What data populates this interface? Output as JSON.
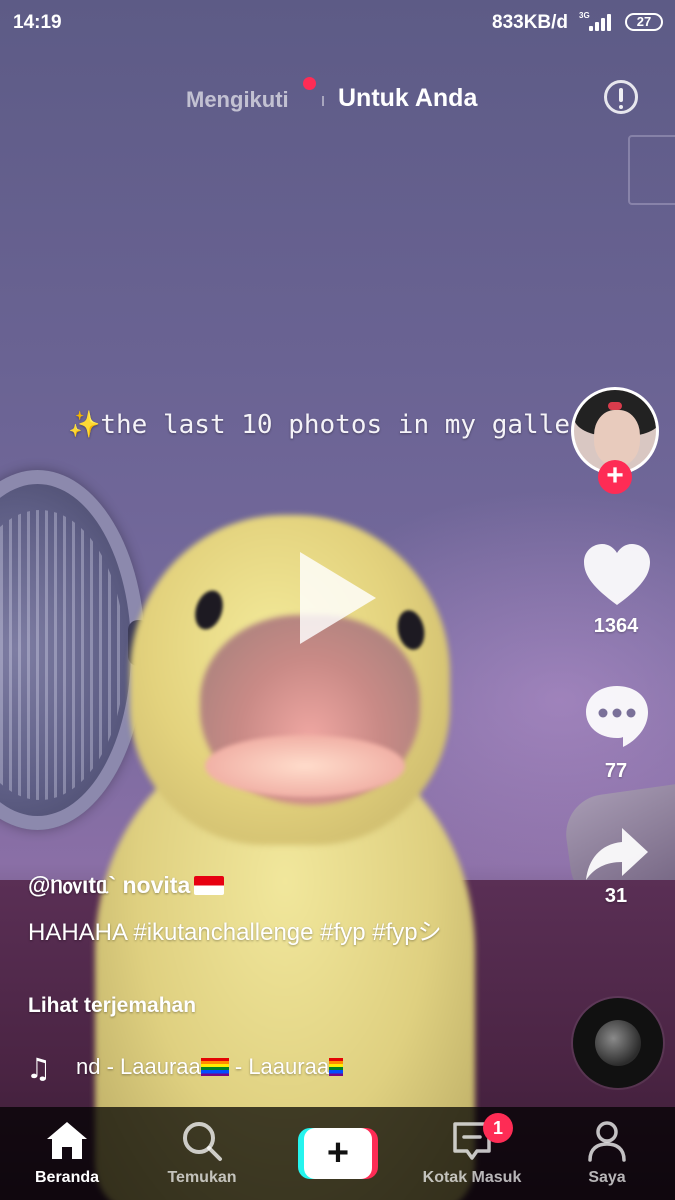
{
  "status_bar": {
    "time": "14:19",
    "network_speed": "833KB/d",
    "network_type": "3G",
    "battery": "27"
  },
  "top_tabs": {
    "following": "Mengikuti",
    "for_you": "Untuk Anda",
    "active": "for_you"
  },
  "video": {
    "overlay_caption": "the last 10 photos in my gallery",
    "state": "paused"
  },
  "actions": {
    "likes": "1364",
    "comments": "77",
    "shares": "31"
  },
  "post": {
    "username": "@ᥒ᥆᥎ιtᥲ` novita",
    "description": "HAHAHA #ikutanchallenge #fyp #fypシ",
    "translate_label": "Lihat terjemahan",
    "music_part1": "nd - Laauraa",
    "music_part2": " - Laauraa"
  },
  "bottom_nav": {
    "home": "Beranda",
    "discover": "Temukan",
    "create": "+",
    "inbox": "Kotak Masuk",
    "inbox_badge": "1",
    "profile": "Saya",
    "active": "home"
  },
  "colors": {
    "accent": "#fe2c55",
    "create_cyan": "#25f4ee"
  },
  "icons": [
    "heart-icon",
    "comment-icon",
    "share-icon",
    "music-note-icon",
    "home-icon",
    "search-icon",
    "inbox-icon",
    "profile-icon",
    "alert-icon"
  ]
}
